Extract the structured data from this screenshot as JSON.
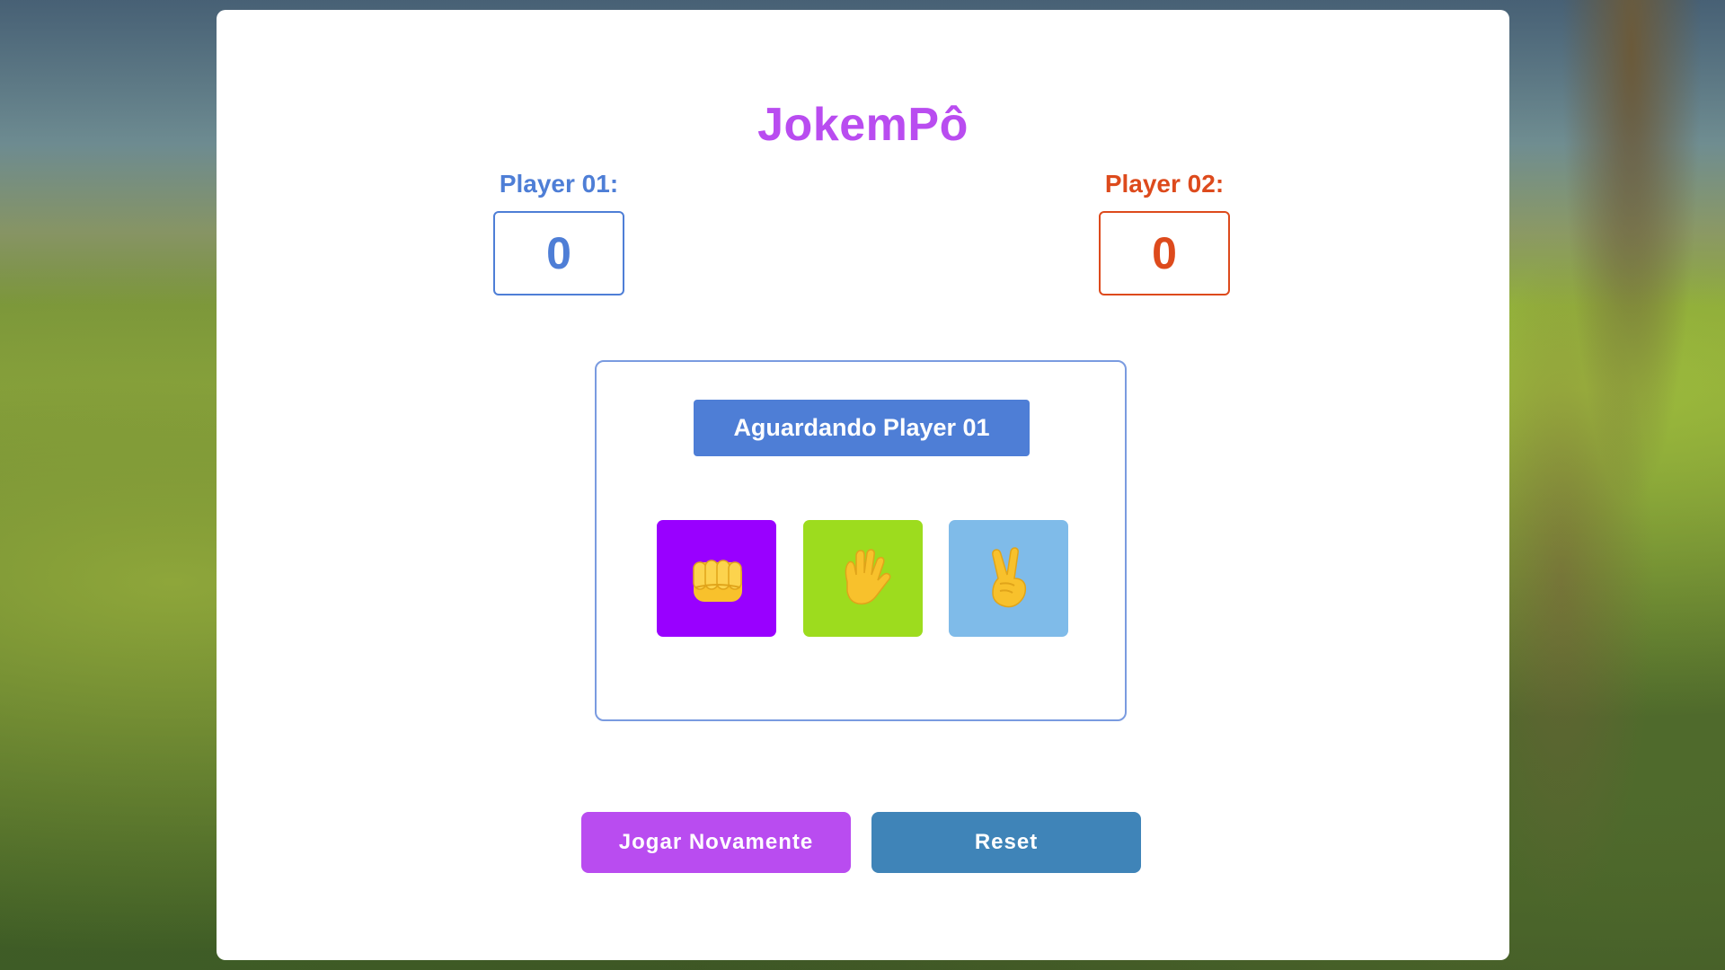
{
  "game": {
    "title": "JokemPô"
  },
  "players": {
    "p1": {
      "label": "Player 01:",
      "score": "0",
      "color": "#4e7ed6"
    },
    "p2": {
      "label": "Player 02:",
      "score": "0",
      "color": "#dd4a1c"
    }
  },
  "board": {
    "status": "Aguardando Player 01",
    "choices": [
      {
        "name": "pedra",
        "icon": "fist-icon",
        "color": "#9900ff"
      },
      {
        "name": "papel",
        "icon": "open-hand-icon",
        "color": "#9ddc1e"
      },
      {
        "name": "tesoura",
        "icon": "victory-hand-icon",
        "color": "#7fbbe9"
      }
    ]
  },
  "actions": {
    "play_again_label": "Jogar Novamente",
    "reset_label": "Reset"
  },
  "colors": {
    "accent_purple": "#b94cf0",
    "button_blue": "#3f84b8",
    "emoji_yellow": "#f8c12c"
  }
}
